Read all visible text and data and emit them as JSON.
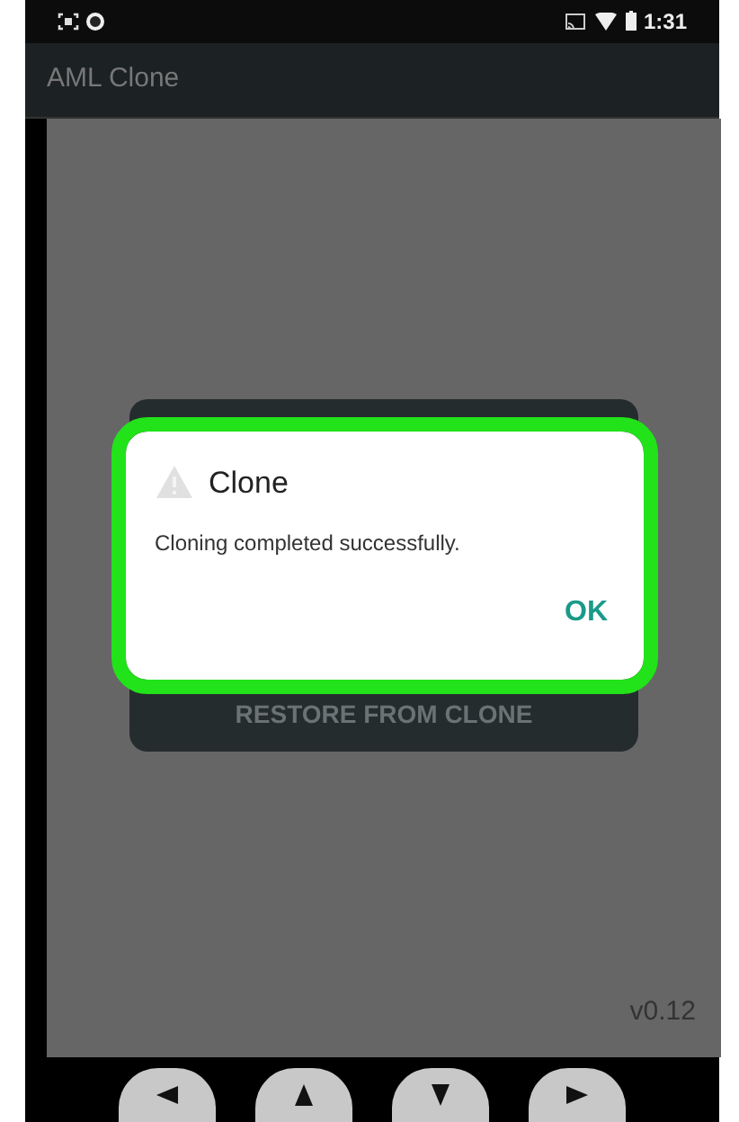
{
  "status_bar": {
    "time": "1:31"
  },
  "app_bar": {
    "title": "AML Clone"
  },
  "background_card": {
    "button_label": "RESTORE FROM CLONE"
  },
  "dialog": {
    "title": "Clone",
    "message": "Cloning completed successfully.",
    "button": "OK",
    "highlighted": true
  },
  "version": "v0.12",
  "nav_buttons": [
    {
      "kind": "left"
    },
    {
      "kind": "up"
    },
    {
      "kind": "down"
    },
    {
      "kind": "right"
    }
  ]
}
